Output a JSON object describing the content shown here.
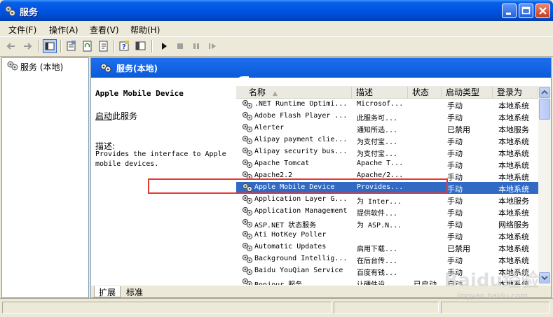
{
  "window": {
    "title": "服务"
  },
  "menu": [
    {
      "label": "文件(F)"
    },
    {
      "label": "操作(A)"
    },
    {
      "label": "查看(V)"
    },
    {
      "label": "帮助(H)"
    }
  ],
  "tree": {
    "root_label": "服务 (本地)"
  },
  "panel": {
    "header": "服务(本地)"
  },
  "description": {
    "service_name": "Apple Mobile Device",
    "start_link": "启动",
    "start_suffix": "此服务",
    "label": "描述:",
    "text": "Provides the interface to Apple mobile devices."
  },
  "columns": [
    "名称",
    "描述",
    "状态",
    "启动类型",
    "登录为"
  ],
  "services": [
    {
      "name": ".NET Runtime Optimi...",
      "desc": "Microsof...",
      "status": "",
      "start": "手动",
      "logon": "本地系统"
    },
    {
      "name": "Adobe Flash Player ...",
      "desc": "此服务可...",
      "status": "",
      "start": "手动",
      "logon": "本地系统"
    },
    {
      "name": "Alerter",
      "desc": "通知所选...",
      "status": "",
      "start": "已禁用",
      "logon": "本地服务"
    },
    {
      "name": "Alipay payment clie...",
      "desc": "为支付宝...",
      "status": "",
      "start": "手动",
      "logon": "本地系统"
    },
    {
      "name": "Alipay security bus...",
      "desc": "为支付宝...",
      "status": "",
      "start": "手动",
      "logon": "本地系统"
    },
    {
      "name": "Apache Tomcat",
      "desc": "Apache T...",
      "status": "",
      "start": "手动",
      "logon": "本地系统"
    },
    {
      "name": "Apache2.2",
      "desc": "Apache/2...",
      "status": "",
      "start": "手动",
      "logon": "本地系统"
    },
    {
      "name": "Apple Mobile Device",
      "desc": "Provides...",
      "status": "",
      "start": "手动",
      "logon": "本地系统",
      "selected": true
    },
    {
      "name": "Application Layer G...",
      "desc": "为 Inter...",
      "status": "",
      "start": "手动",
      "logon": "本地服务"
    },
    {
      "name": "Application Management",
      "desc": "提供软件...",
      "status": "",
      "start": "手动",
      "logon": "本地系统"
    },
    {
      "name": "ASP.NET 状态服务",
      "desc": "为 ASP.N...",
      "status": "",
      "start": "手动",
      "logon": "网络服务"
    },
    {
      "name": "Ati HotKey Poller",
      "desc": "",
      "status": "",
      "start": "手动",
      "logon": "本地系统"
    },
    {
      "name": "Automatic Updates",
      "desc": "启用下载...",
      "status": "",
      "start": "已禁用",
      "logon": "本地系统"
    },
    {
      "name": "Background Intellig...",
      "desc": "在后台传...",
      "status": "",
      "start": "手动",
      "logon": "本地系统"
    },
    {
      "name": "Baidu YouQian Service",
      "desc": "百度有钱...",
      "status": "",
      "start": "手动",
      "logon": "本地系统"
    },
    {
      "name": "Bonjour 服务",
      "desc": "让硬件设...",
      "status": "已启动",
      "start": "自动",
      "logon": "本地系统"
    }
  ],
  "tabs": [
    "扩展",
    "标准"
  ],
  "watermark": {
    "main": "Baidu经验",
    "sub": "jingyan.baidu.com"
  },
  "colors": {
    "accent": "#0A5FE8",
    "selection": "#316AC5",
    "highlight_box": "#E53935"
  }
}
